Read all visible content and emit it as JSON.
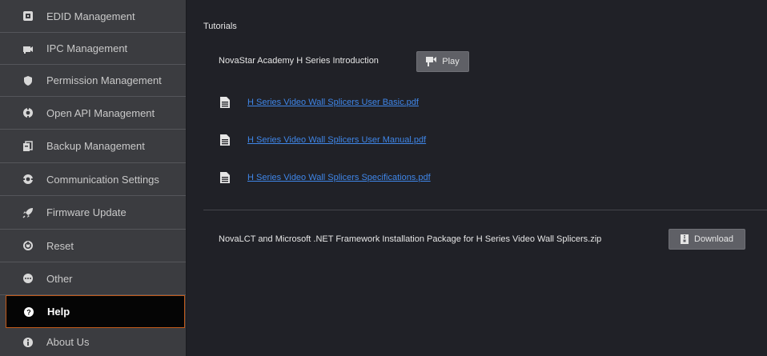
{
  "sidebar": {
    "items": [
      {
        "label": "EDID Management",
        "icon": "edid-icon",
        "active": false
      },
      {
        "label": "IPC Management",
        "icon": "ipc-icon",
        "active": false
      },
      {
        "label": "Permission Management",
        "icon": "shield-icon",
        "active": false
      },
      {
        "label": "Open API Management",
        "icon": "api-icon",
        "active": false
      },
      {
        "label": "Backup Management",
        "icon": "backup-icon",
        "active": false
      },
      {
        "label": "Communication Settings",
        "icon": "communication-icon",
        "active": false
      },
      {
        "label": "Firmware Update",
        "icon": "rocket-icon",
        "active": false
      },
      {
        "label": "Reset",
        "icon": "reset-icon",
        "active": false
      },
      {
        "label": "Other",
        "icon": "other-icon",
        "active": false
      },
      {
        "label": "Help",
        "icon": "question-icon",
        "active": true
      },
      {
        "label": "About Us",
        "icon": "info-icon",
        "active": false
      }
    ]
  },
  "main": {
    "section_title": "Tutorials",
    "academy": {
      "label": "NovaStar Academy H Series Introduction",
      "button": "Play"
    },
    "documents": [
      {
        "name": "H Series Video Wall Splicers User Basic.pdf"
      },
      {
        "name": "H Series Video Wall Splicers User Manual.pdf"
      },
      {
        "name": "H Series Video Wall Splicers Specifications.pdf"
      }
    ],
    "package": {
      "label": "NovaLCT and Microsoft .NET Framework Installation Package for H Series Video Wall Splicers.zip",
      "button": "Download"
    }
  },
  "colors": {
    "sidebar_bg": "#3b3c40",
    "content_bg": "#202127",
    "active_border": "#c25a1a",
    "link": "#3f86e8"
  }
}
